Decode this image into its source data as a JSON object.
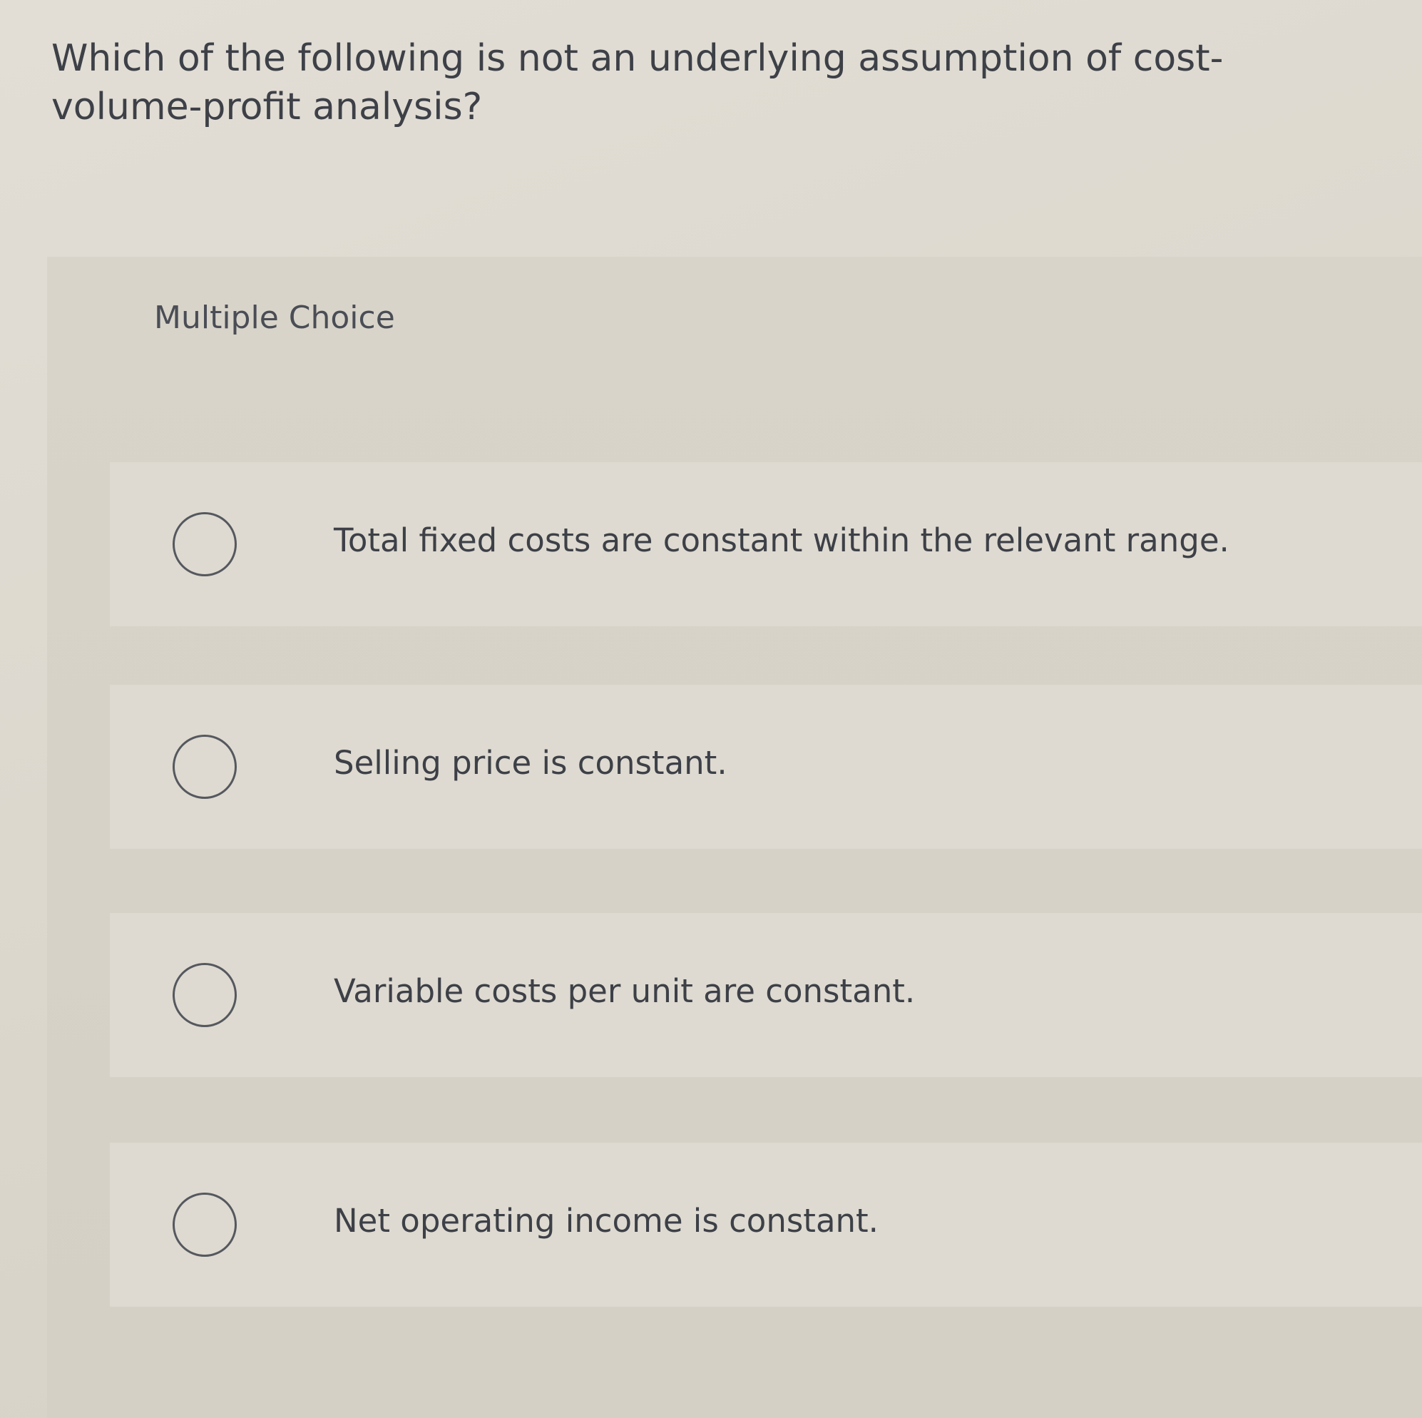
{
  "question": {
    "text": "Which of the following is not an underlying assumption of cost-volume-profit analysis?"
  },
  "multiple_choice": {
    "label": "Multiple Choice",
    "options": [
      {
        "label": "Total fixed costs are constant within the relevant range.",
        "selected": false
      },
      {
        "label": "Selling price is constant.",
        "selected": false
      },
      {
        "label": "Variable costs per unit are constant.",
        "selected": false
      },
      {
        "label": "Net operating income is constant.",
        "selected": false
      }
    ]
  }
}
